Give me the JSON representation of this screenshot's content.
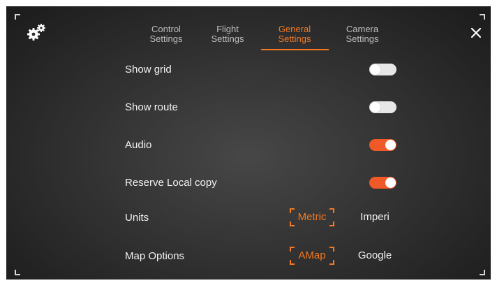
{
  "header": {
    "settings_icon": "gears-icon",
    "close_icon": "close-icon",
    "tabs": [
      {
        "line1": "Control",
        "line2": "Settings",
        "active": false
      },
      {
        "line1": "Flight",
        "line2": "Settings",
        "active": false
      },
      {
        "line1": "General",
        "line2": "Settings",
        "active": true
      },
      {
        "line1": "Camera",
        "line2": "Settings",
        "active": false
      }
    ]
  },
  "settings": {
    "show_grid": {
      "label": "Show grid",
      "enabled": false
    },
    "show_route": {
      "label": "Show route",
      "enabled": false
    },
    "audio": {
      "label": "Audio",
      "enabled": true
    },
    "reserve_local_copy": {
      "label": "Reserve Local copy",
      "enabled": true
    },
    "units": {
      "label": "Units",
      "options": [
        "Metric",
        "Imperi"
      ],
      "selected": "Metric"
    },
    "map_options": {
      "label": "Map Options",
      "options": [
        "AMap",
        "Google"
      ],
      "selected": "AMap"
    }
  },
  "colors": {
    "accent": "#f47920",
    "toggle_on": "#f05a28",
    "toggle_off": "#e7e7e7",
    "text": "#f2f2f2",
    "tab_inactive": "#bdbdbd"
  }
}
